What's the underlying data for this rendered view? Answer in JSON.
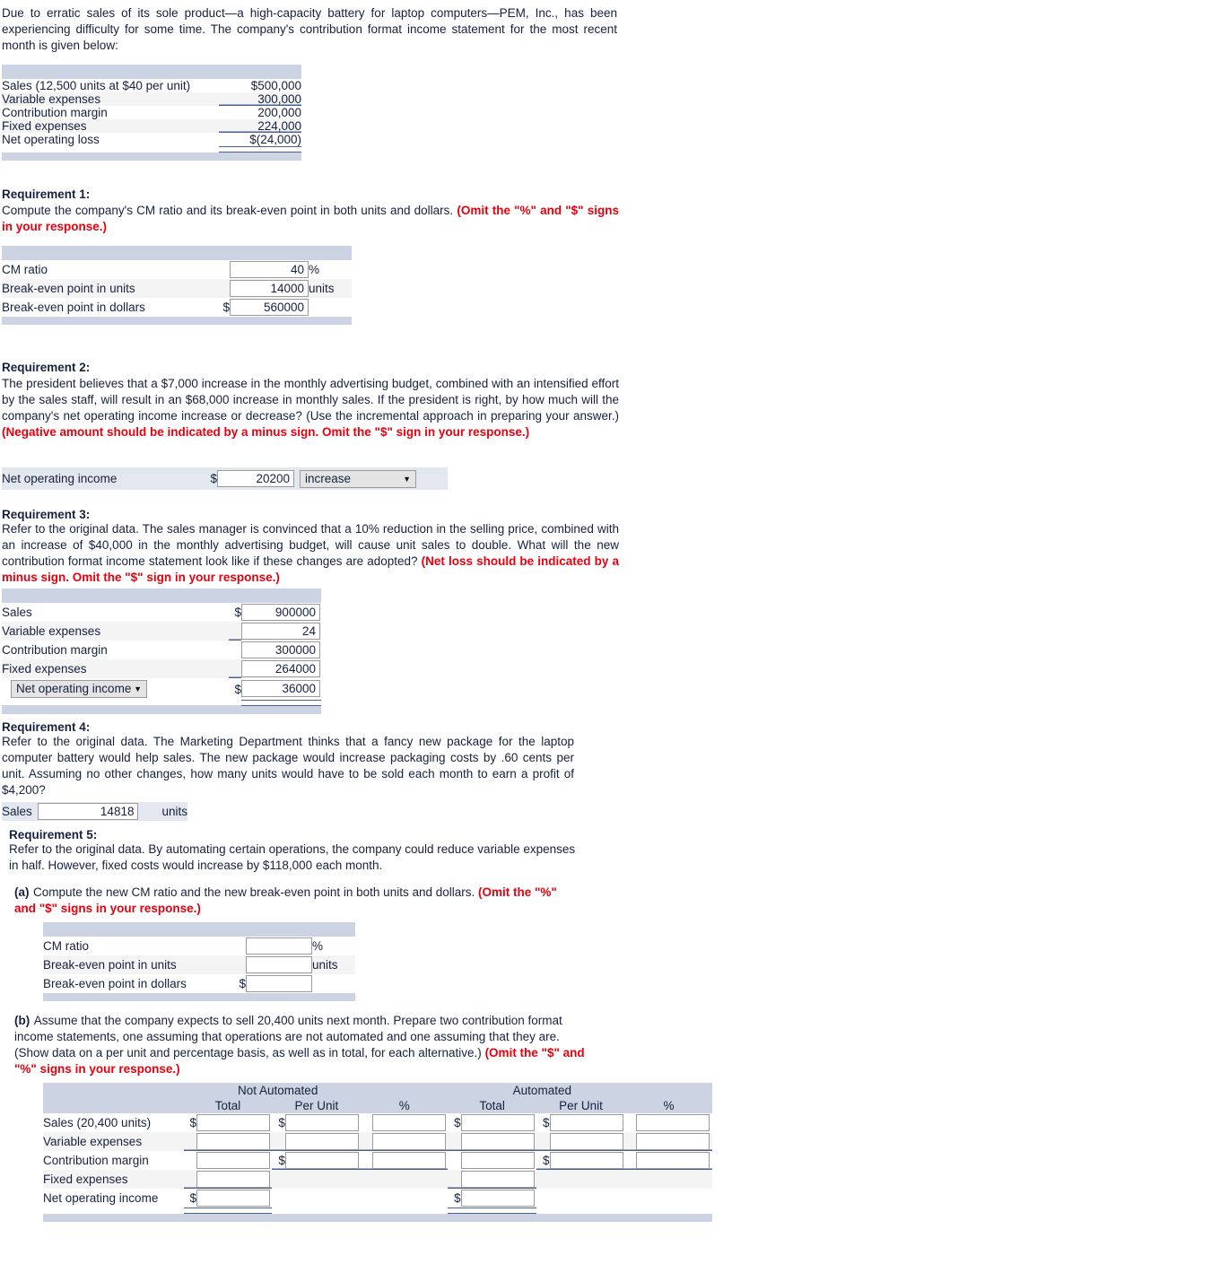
{
  "intro": {
    "text": "Due to erratic sales of its sole product—a high-capacity battery for laptop computers—PEM, Inc., has been experiencing difficulty for some time. The company's contribution format income statement for the most recent month is given below:"
  },
  "income_statement": {
    "rows": [
      {
        "label": "Sales (12,500 units at $40 per unit)",
        "value": "$500,000"
      },
      {
        "label": "Variable expenses",
        "value": "300,000"
      },
      {
        "label": "Contribution margin",
        "value": "200,000"
      },
      {
        "label": "Fixed expenses",
        "value": "224,000"
      },
      {
        "label": "Net operating loss",
        "value": "$(24,000)"
      }
    ]
  },
  "requirement1": {
    "title": "Requirement 1:",
    "prompt_black": "Compute the company's CM ratio and its break-even point in both units and dollars. ",
    "prompt_red": "(Omit the \"%\" and \"$\" signs in your response.)",
    "rows": [
      {
        "label": "CM ratio",
        "dollar": "",
        "value": "40",
        "suffix": "%"
      },
      {
        "label": "Break-even point in units",
        "dollar": "",
        "value": "14000",
        "suffix": "units"
      },
      {
        "label": "Break-even point in dollars",
        "dollar": "$",
        "value": "560000",
        "suffix": ""
      }
    ]
  },
  "requirement2": {
    "title": "Requirement 2:",
    "prompt_black": "The president believes that a $7,000 increase in the monthly advertising budget, combined with an intensified effort by the sales staff, will result in an $68,000 increase in monthly sales. If the president is right, by how much will the company's net operating income increase or decrease? (Use the incremental approach in preparing your answer.) ",
    "prompt_red": "(Negative amount should be indicated by a minus sign. Omit the \"$\" sign in your response.)",
    "row": {
      "label": "Net operating income",
      "dollar": "$",
      "value": "20200",
      "select_value": "increase"
    }
  },
  "requirement3": {
    "title": "Requirement 3:",
    "prompt_black": "Refer to the original data. The sales manager is convinced that a 10% reduction in the selling price, combined with an increase of $40,000 in the monthly advertising budget, will cause unit sales to double. What will the new contribution format income statement look like if these changes are adopted? ",
    "prompt_red": "(Net loss should be indicated by a minus sign. Omit the \"$\" sign in your response.)",
    "rows": [
      {
        "label": "Sales",
        "dollar": "$",
        "value": "900000",
        "is_select": false
      },
      {
        "label": "Variable expenses",
        "dollar": "",
        "value": "24",
        "is_select": false
      },
      {
        "label": "Contribution margin",
        "dollar": "",
        "value": "300000",
        "is_select": false
      },
      {
        "label": "Fixed expenses",
        "dollar": "",
        "value": "264000",
        "is_select": false
      },
      {
        "label": "Net operating income",
        "dollar": "$",
        "value": "36000",
        "is_select": true
      }
    ]
  },
  "requirement4": {
    "title": "Requirement 4:",
    "prompt_black": "Refer to the original data. The Marketing Department thinks that a fancy new package for the laptop computer battery would help sales. The new package would increase packaging costs by .60 cents per unit. Assuming no other changes, how many units would have to be sold each month to earn a profit of $4,200?",
    "row": {
      "label": "Sales",
      "value": "14818",
      "suffix": "units"
    }
  },
  "requirement5": {
    "title": "Requirement 5:",
    "prompt_black": "Refer to the original data. By automating certain operations, the company could reduce variable expenses in half. However, fixed costs would increase by $118,000 each month.",
    "part_a": {
      "marker": "(a)",
      "text_black": "Compute the new CM ratio and the new break-even point in both units and dollars. ",
      "text_red": "(Omit the \"%\" and \"$\" signs in your response.)",
      "rows": [
        {
          "label": "CM ratio",
          "dollar": "",
          "value": "",
          "suffix": "%"
        },
        {
          "label": "Break-even point in units",
          "dollar": "",
          "value": "",
          "suffix": "units"
        },
        {
          "label": "Break-even point in dollars",
          "dollar": "$",
          "value": "",
          "suffix": ""
        }
      ]
    },
    "part_b": {
      "marker": "(b)",
      "text_black": "Assume that the company expects to sell 20,400 units next month. Prepare two contribution format income statements, one assuming that operations are not automated and one assuming that they are. (Show data on a per unit and percentage basis, as well as in total, for each alternative.) ",
      "text_red": "(Omit the \"$\" and \"%\" signs in your response.)",
      "group_headers": [
        "Not Automated",
        "Automated"
      ],
      "column_headers": [
        "Total",
        "Per Unit",
        "%",
        "Total",
        "Per Unit",
        "%"
      ],
      "rows": [
        {
          "label": "Sales (20,400 units)",
          "cells": [
            "",
            "",
            "",
            "",
            "",
            ""
          ]
        },
        {
          "label": "Variable expenses",
          "cells": [
            "",
            "",
            "",
            "",
            "",
            ""
          ]
        },
        {
          "label": "Contribution margin",
          "cells": [
            "",
            "",
            "",
            "",
            "",
            ""
          ]
        },
        {
          "label": "Fixed expenses",
          "cells": [
            "",
            null,
            null,
            "",
            null,
            null
          ]
        },
        {
          "label": "Net operating income",
          "cells": [
            "",
            null,
            null,
            "",
            null,
            null
          ]
        }
      ]
    }
  },
  "colors": {
    "band": "#ccd3e2",
    "red": "#e8000d",
    "rule": "#48618f",
    "text": "#16213e"
  }
}
